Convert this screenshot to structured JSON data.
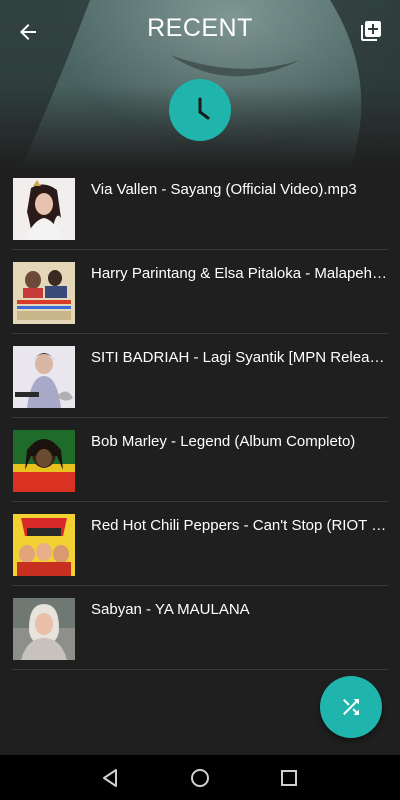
{
  "header": {
    "title": "RECENT",
    "back_icon": "arrow-left-icon",
    "add_icon": "playlist-add-icon",
    "badge_icon": "clock-icon"
  },
  "colors": {
    "accent": "#1fb5ac",
    "background": "#1f1f1f",
    "divider": "#3a3a3a",
    "navbar": "#000000"
  },
  "tracks": [
    {
      "title": "Via Vallen - Sayang (Official Video).mp3"
    },
    {
      "title": "Harry Parintang & Elsa Pitaloka - Malapeh Ayie Mato"
    },
    {
      "title": "SITI BADRIAH - Lagi Syantik [MPN Release]"
    },
    {
      "title": "Bob Marley - Legend (Album Completo)"
    },
    {
      "title": "Red Hot Chili Peppers - Can't Stop (RIOT Remix)"
    },
    {
      "title": "Sabyan - YA MAULANA"
    }
  ],
  "fab": {
    "icon": "shuffle-icon"
  },
  "navbar": {
    "back_icon": "nav-back-icon",
    "home_icon": "nav-home-icon",
    "recents_icon": "nav-recents-icon"
  }
}
